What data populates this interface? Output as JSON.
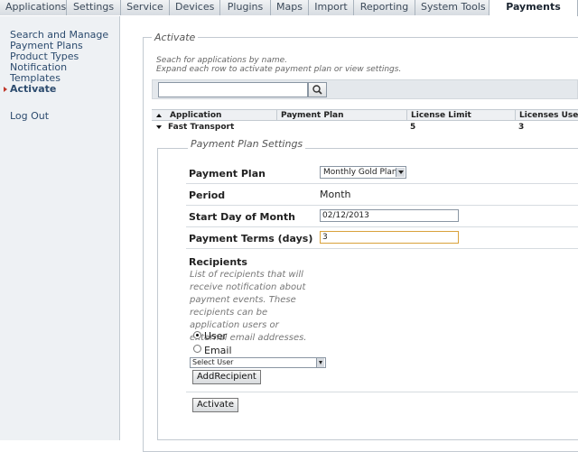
{
  "tabs": [
    "Applications",
    "Settings",
    "Service",
    "Devices",
    "Plugins",
    "Maps",
    "Import",
    "Reporting",
    "System Tools",
    "Payments"
  ],
  "active_tab": "Payments",
  "sidebar": {
    "items": [
      "Search and Manage",
      "Payment Plans",
      "Product Types",
      "Notification Templates",
      "Activate"
    ],
    "logout": "Log Out"
  },
  "main": {
    "legend": "Activate",
    "hint_line1": "Seach for applications by name.",
    "hint_line2": "Expand each row to activate payment plan or view settings.",
    "search": {
      "value": ""
    },
    "table": {
      "headers": [
        "Application",
        "Payment Plan",
        "License Limit",
        "Licenses Used"
      ],
      "row": {
        "application": "Fast Transport",
        "payment_plan": "",
        "license_limit": "5",
        "licenses_used": "3"
      }
    },
    "settings": {
      "legend": "Payment Plan Settings",
      "payment_plan_label": "Payment Plan",
      "payment_plan_value": "Monthly Gold Plan",
      "period_label": "Period",
      "period_value": "Month",
      "start_label": "Start Day of Month",
      "start_value": "02/12/2013",
      "terms_label": "Payment Terms (days)",
      "terms_value": "3",
      "recipients_label": "Recipients",
      "recipients_help": "List of recipients that will receive notification about payment events. These recipients can be application users or external email addresses.",
      "radio_user": "User",
      "radio_email": "Email",
      "user_select": "Select User",
      "add_button": "AddRecipient",
      "activate_button": "Activate"
    }
  },
  "colors": {
    "accent": "#2c4b6e",
    "focus": "#d9a23b",
    "marker": "#c0392b"
  }
}
